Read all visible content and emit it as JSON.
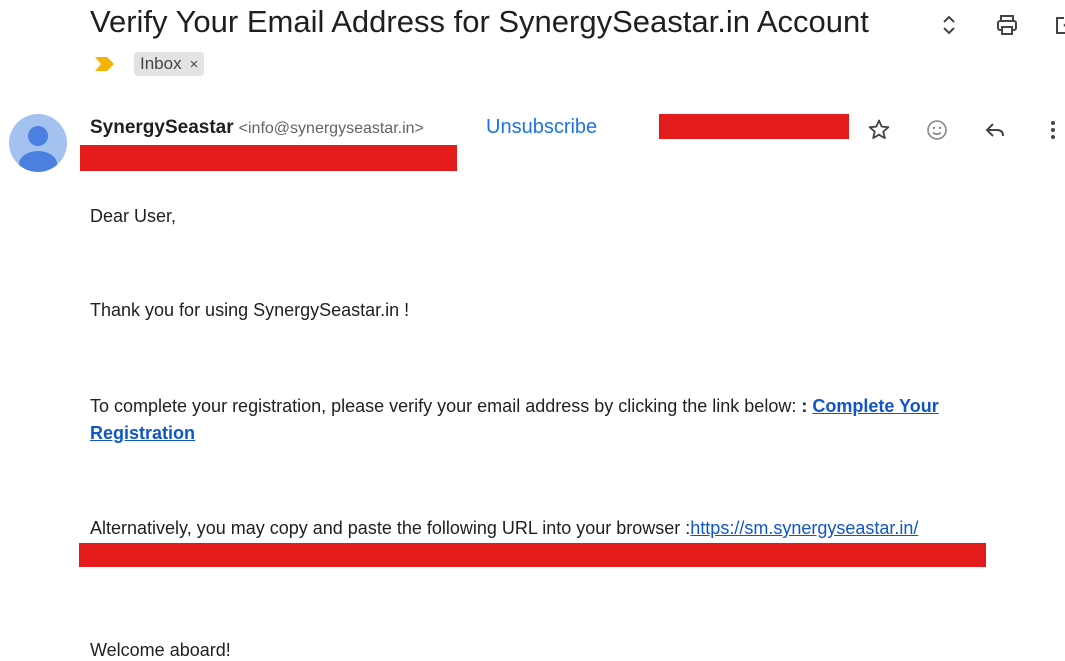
{
  "email": {
    "subject": "Verify Your Email Address for SynergySeastar.in Account",
    "labels": [
      {
        "name": "Inbox",
        "remove_glyph": "×"
      }
    ],
    "sender": {
      "name": "SynergySeastar",
      "email": "<info@synergyseastar.in>"
    },
    "unsubscribe_label": "Unsubscribe"
  },
  "toolbar_icons": [
    "expand-collapse-icon",
    "print-icon",
    "open-in-new-window-icon"
  ],
  "message_actions": [
    "star-icon",
    "emoji-reaction-icon",
    "reply-icon",
    "more-options-icon"
  ],
  "body": {
    "greeting": "Dear User,",
    "thanks": "Thank you for using SynergySeastar.in !",
    "verify_prefix": "To complete your registration, please verify your email address by clicking the link below: ",
    "verify_colon": ":",
    "verify_link": "Complete Your Registration",
    "alt_prefix": "Alternatively, you may copy and paste the following URL into your browser :",
    "alt_url": "https://sm.synergyseastar.in/",
    "closing": "Welcome aboard!"
  },
  "colors": {
    "link": "#1155cc",
    "unsubscribe": "#1a73e8",
    "redaction": "#e31b1b",
    "importance_marker": "#f4b400",
    "avatar_bg": "#a3c2ef",
    "avatar_fg": "#4b7fe0"
  }
}
